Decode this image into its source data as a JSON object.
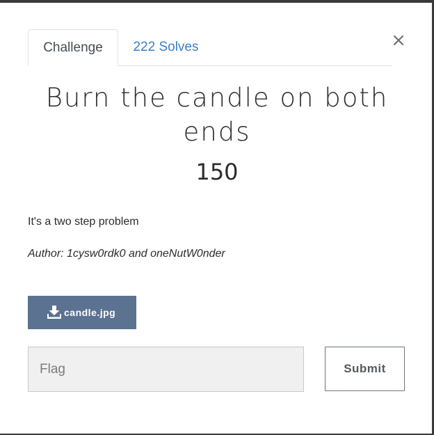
{
  "tabs": [
    {
      "label": "Challenge",
      "active": true
    },
    {
      "label": "222 Solves",
      "active": false
    }
  ],
  "close_label": "×",
  "challenge": {
    "title": "Burn the candle on both ends",
    "points": "150",
    "description": "It's a two step problem",
    "author": "Author: 1cysw0rdk0 and oneNutW0nder"
  },
  "file": {
    "name": "candle.jpg",
    "icon": "download-icon"
  },
  "flag_input": {
    "placeholder": "Flag",
    "value": ""
  },
  "submit_label": "Submit",
  "colors": {
    "file_button": "#5b7290",
    "tab_link": "#3a7fc1",
    "input_bg": "#f0f0f0"
  }
}
